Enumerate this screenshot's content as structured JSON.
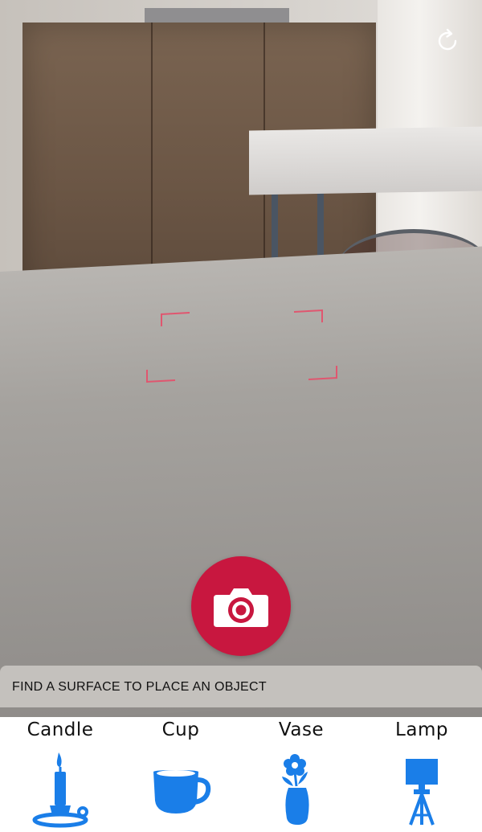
{
  "status": {
    "message": "FIND A SURFACE TO PLACE AN OBJECT"
  },
  "controls": {
    "reset_icon": "reset-icon",
    "shutter_icon": "camera-icon"
  },
  "objects": [
    {
      "label": "Candle",
      "icon": "candle-icon"
    },
    {
      "label": "Cup",
      "icon": "cup-icon"
    },
    {
      "label": "Vase",
      "icon": "vase-icon"
    },
    {
      "label": "Lamp",
      "icon": "lamp-icon"
    }
  ],
  "colors": {
    "accent_blue": "#1a7ee8",
    "shutter_red": "#c8173f",
    "focus_square": "#e0566f"
  }
}
